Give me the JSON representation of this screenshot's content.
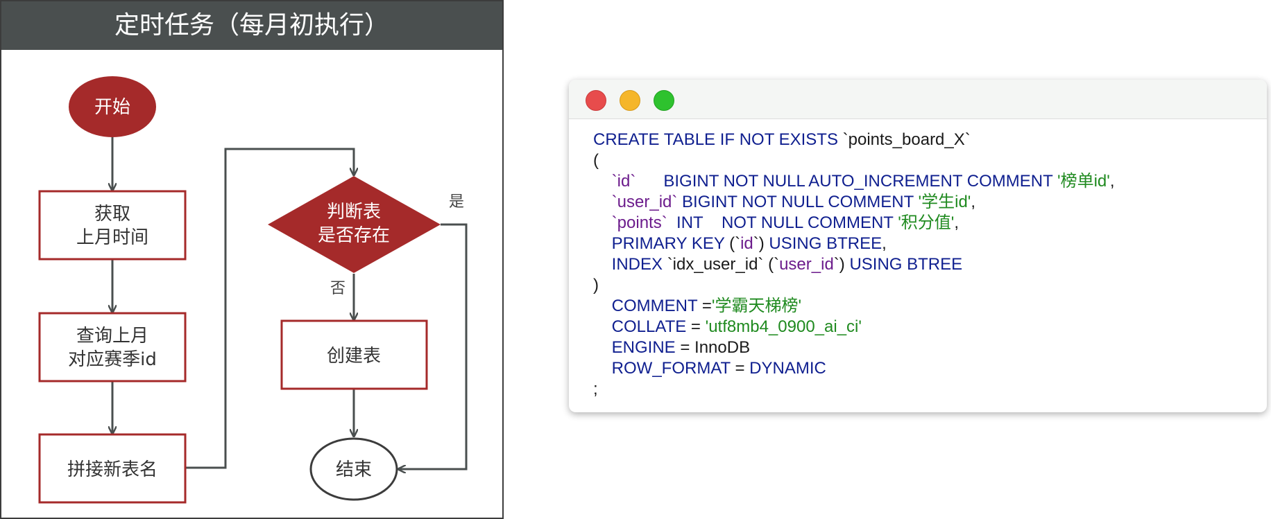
{
  "flowchart": {
    "title": "定时任务（每月初执行）",
    "start": "开始",
    "step1": [
      "获取",
      "上月时间"
    ],
    "step2": [
      "查询上月",
      "对应赛季id"
    ],
    "step3": "拼接新表名",
    "decision": [
      "判断表",
      "是否存在"
    ],
    "yes_label": "是",
    "no_label": "否",
    "create": "创建表",
    "end": "结束",
    "colors": {
      "accent": "#a52a2a",
      "header": "#4a4f4f",
      "line": "#4a4f4f"
    }
  },
  "code_window": {
    "traffic_lights": [
      "#e74c4c",
      "#f5b62a",
      "#2ec22e"
    ],
    "lines": [
      [
        {
          "t": "CREATE TABLE IF NOT EXISTS ",
          "c": "kw"
        },
        {
          "t": "`points_board_X`",
          "c": "plain"
        }
      ],
      [
        {
          "t": "(",
          "c": "plain"
        }
      ],
      [
        {
          "t": "    ",
          "c": "plain"
        },
        {
          "t": "`id`",
          "c": "col"
        },
        {
          "t": "      BIGINT NOT NULL AUTO_INCREMENT COMMENT ",
          "c": "kw"
        },
        {
          "t": "'榜单id'",
          "c": "str"
        },
        {
          "t": ",",
          "c": "plain"
        }
      ],
      [
        {
          "t": "    ",
          "c": "plain"
        },
        {
          "t": "`user_id`",
          "c": "col"
        },
        {
          "t": " BIGINT NOT NULL COMMENT ",
          "c": "kw"
        },
        {
          "t": "'学生id'",
          "c": "str"
        },
        {
          "t": ",",
          "c": "plain"
        }
      ],
      [
        {
          "t": "    ",
          "c": "plain"
        },
        {
          "t": "`points`",
          "c": "col"
        },
        {
          "t": "  INT    NOT NULL COMMENT ",
          "c": "kw"
        },
        {
          "t": "'积分值'",
          "c": "str"
        },
        {
          "t": ",",
          "c": "plain"
        }
      ],
      [
        {
          "t": "    ",
          "c": "plain"
        },
        {
          "t": "PRIMARY KEY ",
          "c": "kw"
        },
        {
          "t": "(`",
          "c": "plain"
        },
        {
          "t": "id",
          "c": "col"
        },
        {
          "t": "`) ",
          "c": "plain"
        },
        {
          "t": "USING BTREE",
          "c": "kw"
        },
        {
          "t": ",",
          "c": "plain"
        }
      ],
      [
        {
          "t": "    ",
          "c": "plain"
        },
        {
          "t": "INDEX ",
          "c": "kw"
        },
        {
          "t": "`idx_user_id` (`",
          "c": "plain"
        },
        {
          "t": "user_id",
          "c": "col"
        },
        {
          "t": "`) ",
          "c": "plain"
        },
        {
          "t": "USING BTREE",
          "c": "kw"
        }
      ],
      [
        {
          "t": ")",
          "c": "plain"
        }
      ],
      [
        {
          "t": "    ",
          "c": "plain"
        },
        {
          "t": "COMMENT",
          "c": "kw"
        },
        {
          "t": " =",
          "c": "plain"
        },
        {
          "t": "'学霸天梯榜'",
          "c": "str"
        }
      ],
      [
        {
          "t": "    ",
          "c": "plain"
        },
        {
          "t": "COLLATE",
          "c": "kw"
        },
        {
          "t": " = ",
          "c": "plain"
        },
        {
          "t": "'utf8mb4_0900_ai_ci'",
          "c": "str"
        }
      ],
      [
        {
          "t": "    ",
          "c": "plain"
        },
        {
          "t": "ENGINE",
          "c": "kw"
        },
        {
          "t": " = InnoDB",
          "c": "plain"
        }
      ],
      [
        {
          "t": "    ",
          "c": "plain"
        },
        {
          "t": "ROW_FORMAT",
          "c": "kw"
        },
        {
          "t": " = ",
          "c": "plain"
        },
        {
          "t": "DYNAMIC",
          "c": "kw"
        }
      ],
      [
        {
          "t": ";",
          "c": "plain"
        }
      ]
    ]
  }
}
